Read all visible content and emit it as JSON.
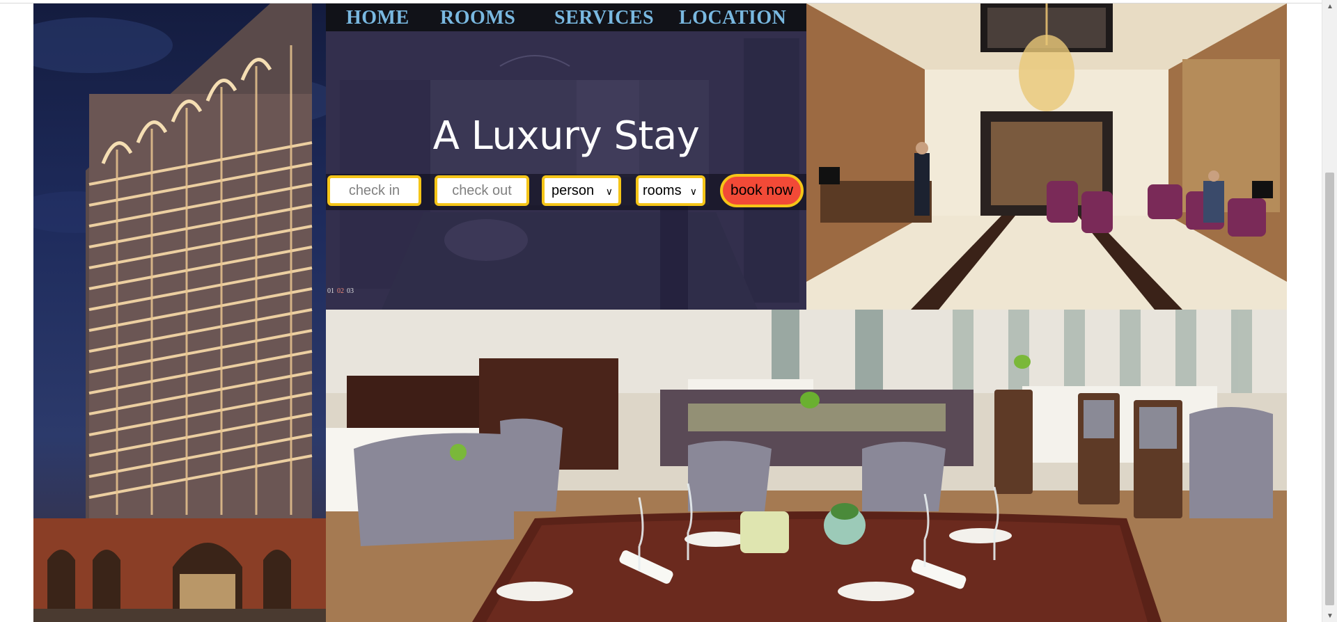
{
  "nav": {
    "items": [
      "HOME",
      "ROOMS",
      "SERVICES",
      "LOCATION"
    ]
  },
  "hero": {
    "title": "A Luxury Stay",
    "slider_indices": [
      "01",
      "02",
      "03"
    ],
    "active_slide": "02"
  },
  "booking": {
    "check_in_placeholder": "check in",
    "check_out_placeholder": "check out",
    "person_label": "person",
    "rooms_label": "rooms",
    "book_label": "book now"
  },
  "images": {
    "tower": "hotel-tower-night-icon",
    "hero_bg": "hotel-room-icon",
    "lobby": "hotel-lobby-icon",
    "restaurant": "restaurant-icon"
  },
  "colors": {
    "nav_text": "#79b8e0",
    "nav_bg": "#111218",
    "field_border": "#f5c518",
    "book_button": "#f24a37"
  }
}
